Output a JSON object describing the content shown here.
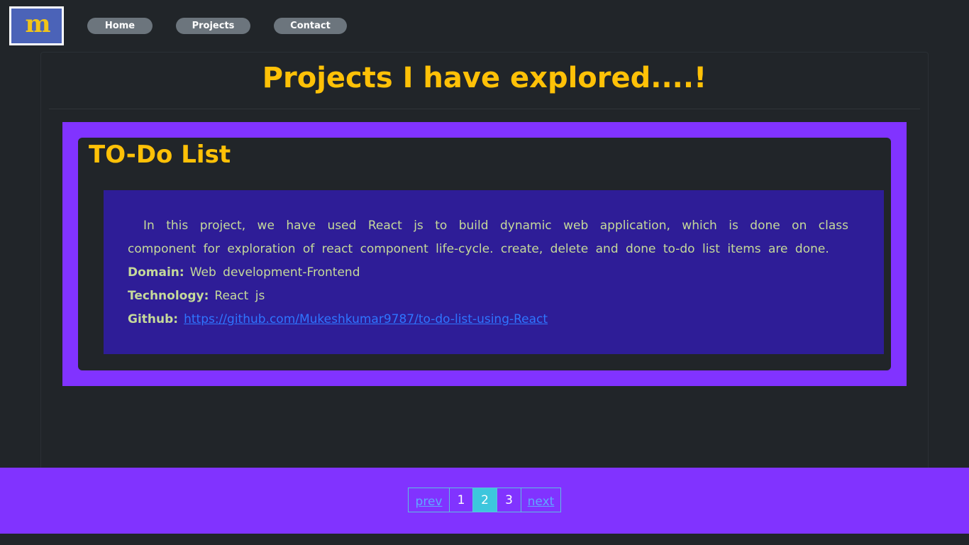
{
  "header": {
    "logo_letter": "m",
    "nav": [
      {
        "label": "Home"
      },
      {
        "label": "Projects"
      },
      {
        "label": "Contact"
      }
    ]
  },
  "main": {
    "title": "Projects I have explored....!",
    "project": {
      "title": "TO-Do List",
      "description": "In this project, we have used React js to build dynamic web application, which is done on class component for exploration of react component life-cycle. create, delete and done to-do list items are done.",
      "domain_label": "Domain:",
      "domain_value": "Web development-Frontend",
      "technology_label": "Technology:",
      "technology_value": "React js",
      "github_label": "Github:",
      "github_url": "https://github.com/Mukeshkumar9787/to-do-list-using-React"
    }
  },
  "pagination": {
    "prev": "prev",
    "pages": [
      "1",
      "2",
      "3"
    ],
    "active_page": "2",
    "next": "next"
  },
  "colors": {
    "background": "#212529",
    "accent_yellow": "#ffc107",
    "purple": "#8133ff",
    "description_bg": "#2e1d97",
    "pager_active": "#3dc6dd"
  }
}
